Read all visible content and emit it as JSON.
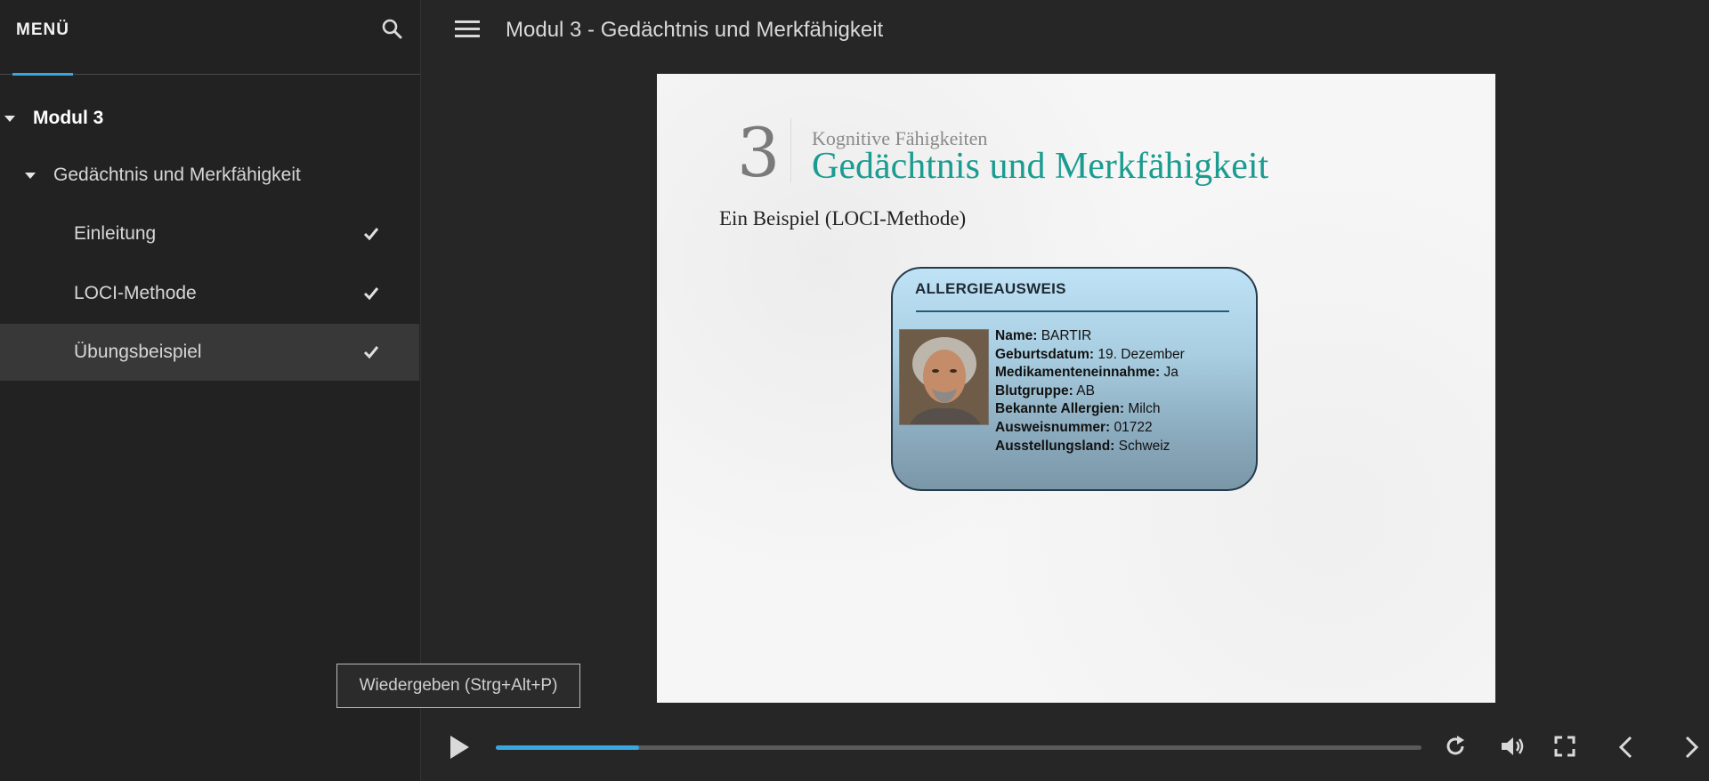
{
  "sidebar": {
    "menu_title": "MENÜ",
    "items": [
      {
        "label": "Modul 3"
      },
      {
        "label": "Gedächtnis und Merkfähigkeit"
      },
      {
        "label": "Einleitung"
      },
      {
        "label": "LOCI-Methode"
      },
      {
        "label": "Übungsbeispiel"
      }
    ]
  },
  "header": {
    "title": "Modul 3 - Gedächtnis und Merkfähigkeit"
  },
  "slide": {
    "number": "3",
    "subtitle": "Kognitive Fähigkeiten",
    "title": "Gedächtnis und Merkfähigkeit",
    "example": "Ein Beispiel (LOCI-Methode)",
    "card": {
      "title": "ALLERGIEAUSWEIS",
      "fields": [
        {
          "label": "Name:",
          "value": "BARTIR"
        },
        {
          "label": "Geburtsdatum:",
          "value": "19. Dezember"
        },
        {
          "label": "Medikamenteneinnahme:",
          "value": "Ja"
        },
        {
          "label": "Blutgruppe:",
          "value": "AB"
        },
        {
          "label": "Bekannte Allergien:",
          "value": "Milch"
        },
        {
          "label": "Ausweisnummer:",
          "value": "01722"
        },
        {
          "label": "Ausstellungsland:",
          "value": "Schweiz"
        }
      ]
    }
  },
  "tooltip": {
    "text": "Wiedergeben (Strg+Alt+P)"
  },
  "player": {
    "progress": 0.155,
    "accent_color": "#3aa6e0",
    "icons": [
      "play-icon",
      "replay-icon",
      "volume-icon",
      "fullscreen-icon",
      "prev-icon",
      "next-icon"
    ]
  }
}
